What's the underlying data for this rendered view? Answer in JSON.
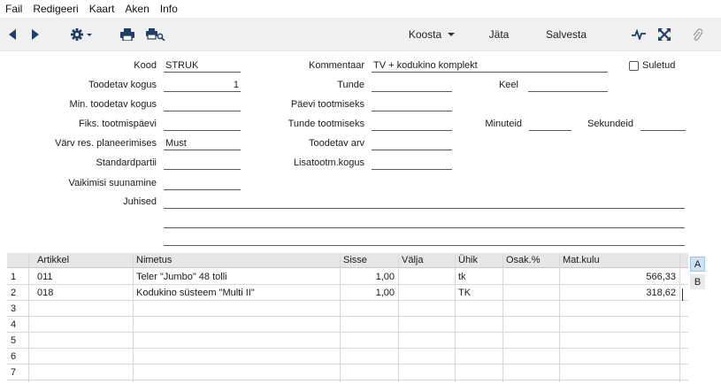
{
  "menu": [
    "Fail",
    "Redigeeri",
    "Kaart",
    "Aken",
    "Info"
  ],
  "toolbar": {
    "koosta_label": "Koosta",
    "jata_label": "Jäta",
    "salvesta_label": "Salvesta"
  },
  "form": {
    "kood": {
      "label": "Kood",
      "value": "STRUK"
    },
    "toodetav_kogus": {
      "label": "Toodetav kogus",
      "value": "1"
    },
    "min_toodetav_kogus": {
      "label": "Min. toodetav kogus",
      "value": ""
    },
    "fiks_tootmispaevi": {
      "label": "Fiks. tootmispäevi",
      "value": ""
    },
    "varv": {
      "label": "Värv res. planeerimises",
      "value": "Must"
    },
    "standardpartii": {
      "label": "Standardpartii",
      "value": ""
    },
    "vaikimisi_suunamine": {
      "label": "Vaikimisi suunamine",
      "value": ""
    },
    "juhised": {
      "label": "Juhised",
      "value": ""
    },
    "kommentaar": {
      "label": "Kommentaar",
      "value": "TV + kodukino komplekt"
    },
    "suletud": {
      "label": "Suletud",
      "checked": false
    },
    "tunde": {
      "label": "Tunde",
      "value": ""
    },
    "keel": {
      "label": "Keel",
      "value": ""
    },
    "paevi_tootmiseks": {
      "label": "Päevi tootmiseks",
      "value": ""
    },
    "tunde_tootmiseks": {
      "label": "Tunde tootmiseks",
      "value": ""
    },
    "minuteid": {
      "label": "Minuteid",
      "value": ""
    },
    "sekundeid": {
      "label": "Sekundeid",
      "value": ""
    },
    "toodetav_arv": {
      "label": "Toodetav arv",
      "value": ""
    },
    "lisatootm_kogus": {
      "label": "Lisatootm.kogus",
      "value": ""
    }
  },
  "grid": {
    "headers": [
      "Artikkel",
      "Nimetus",
      "Sisse",
      "Välja",
      "Ühik",
      "Osak.%",
      "Mat.kulu"
    ],
    "rows": [
      {
        "n": "1",
        "artikkel": "011",
        "nimetus": "Teler \"Jumbo\" 48 tolli",
        "sisse": "1,00",
        "valja": "",
        "uhik": "tk",
        "osak": "",
        "matkulu": "566,33"
      },
      {
        "n": "2",
        "artikkel": "018",
        "nimetus": "Kodukino süsteem \"Multi II\"",
        "sisse": "1,00",
        "valja": "",
        "uhik": "TK",
        "osak": "",
        "matkulu": "318,62"
      },
      {
        "n": "3",
        "artikkel": "",
        "nimetus": "",
        "sisse": "",
        "valja": "",
        "uhik": "",
        "osak": "",
        "matkulu": ""
      },
      {
        "n": "4",
        "artikkel": "",
        "nimetus": "",
        "sisse": "",
        "valja": "",
        "uhik": "",
        "osak": "",
        "matkulu": ""
      },
      {
        "n": "5",
        "artikkel": "",
        "nimetus": "",
        "sisse": "",
        "valja": "",
        "uhik": "",
        "osak": "",
        "matkulu": ""
      },
      {
        "n": "6",
        "artikkel": "",
        "nimetus": "",
        "sisse": "",
        "valja": "",
        "uhik": "",
        "osak": "",
        "matkulu": ""
      },
      {
        "n": "7",
        "artikkel": "",
        "nimetus": "",
        "sisse": "",
        "valja": "",
        "uhik": "",
        "osak": "",
        "matkulu": ""
      }
    ],
    "tabs": [
      "A",
      "B"
    ],
    "active_tab": "A"
  },
  "colors": {
    "toolbar_bg": "#f0f0f0",
    "grid_header_bg": "#e6e6e6",
    "active_tab_bg": "#cfe3f7"
  }
}
